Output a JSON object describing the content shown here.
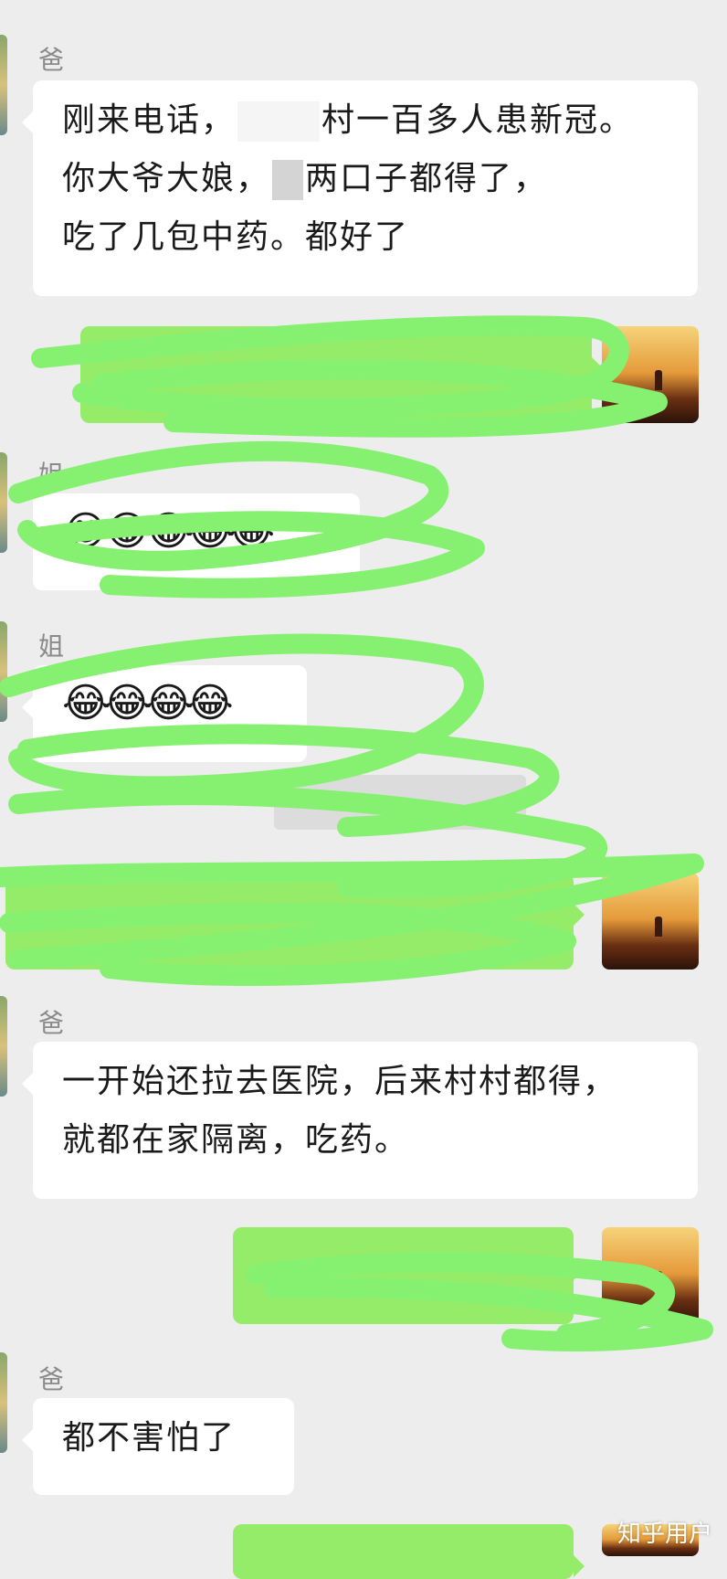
{
  "messages": [
    {
      "sender": "爸",
      "lines": [
        "刚来电话，",
        "村一百多人患新冠。",
        "你大爷大娘，",
        "两口子都得了，",
        "吃了几包中药。都好了"
      ]
    },
    {
      "sender": "姐"
    },
    {
      "sender": "姐"
    },
    {
      "sender": "爸",
      "lines": [
        "一开始还拉去医院，后来村村都得，",
        "就都在家隔离，吃药。"
      ]
    },
    {
      "sender": "爸",
      "lines": [
        "都不害怕了"
      ]
    }
  ],
  "emoji": {
    "row1": "😂😂😂😂😂",
    "row2": "😂😂😂😂"
  },
  "watermark": "知乎用户",
  "colors": {
    "background": "#ededed",
    "received_bubble": "#ffffff",
    "sent_bubble": "#95ec69",
    "scribble": "#86f070"
  }
}
